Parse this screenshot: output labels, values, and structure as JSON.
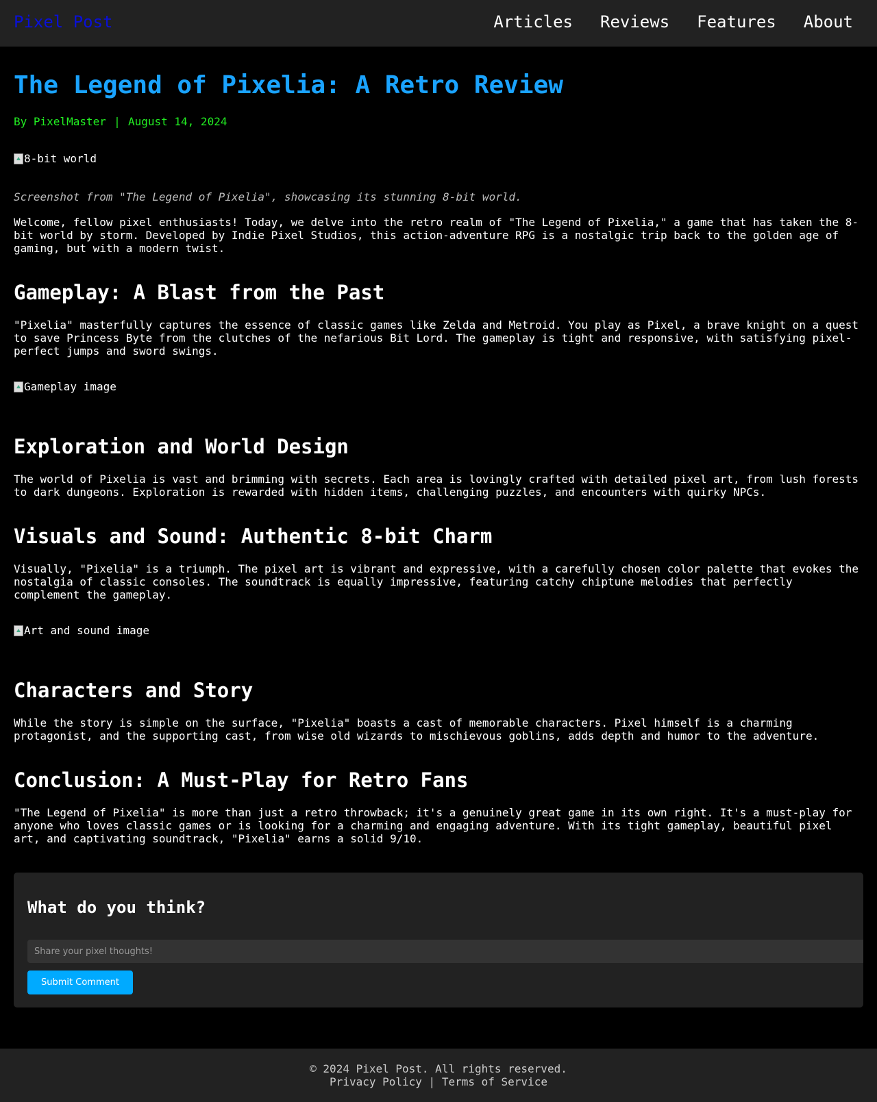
{
  "site": {
    "brand": "Pixel Post",
    "nav": [
      "Articles",
      "Reviews",
      "Features",
      "About"
    ]
  },
  "article": {
    "title": "The Legend of Pixelia: A Retro Review",
    "byline": {
      "author_prefix": "By PixelMaster",
      "separator": "|",
      "date": "August 14, 2024"
    },
    "hero_image_alt": "8-bit world",
    "hero_caption": "Screenshot from \"The Legend of Pixelia\", showcasing its stunning 8-bit world.",
    "intro": "Welcome, fellow pixel enthusiasts! Today, we delve into the retro realm of \"The Legend of Pixelia,\" a game that has taken the 8-bit world by storm. Developed by Indie Pixel Studios, this action-adventure RPG is a nostalgic trip back to the golden age of gaming, but with a modern twist.",
    "sections": [
      {
        "heading": "Gameplay: A Blast from the Past",
        "text": "\"Pixelia\" masterfully captures the essence of classic games like Zelda and Metroid. You play as Pixel, a brave knight on a quest to save Princess Byte from the clutches of the nefarious Bit Lord. The gameplay is tight and responsive, with satisfying pixel-perfect jumps and sword swings.",
        "image_alt": "Gameplay image"
      },
      {
        "heading": "Exploration and World Design",
        "text": "The world of Pixelia is vast and brimming with secrets. Each area is lovingly crafted with detailed pixel art, from lush forests to dark dungeons. Exploration is rewarded with hidden items, challenging puzzles, and encounters with quirky NPCs."
      },
      {
        "heading": "Visuals and Sound: Authentic 8-bit Charm",
        "text": "Visually, \"Pixelia\" is a triumph. The pixel art is vibrant and expressive, with a carefully chosen color palette that evokes the nostalgia of classic consoles. The soundtrack is equally impressive, featuring catchy chiptune melodies that perfectly complement the gameplay.",
        "image_alt": "Art and sound image"
      },
      {
        "heading": "Characters and Story",
        "text": "While the story is simple on the surface, \"Pixelia\" boasts a cast of memorable characters. Pixel himself is a charming protagonist, and the supporting cast, from wise old wizards to mischievous goblins, adds depth and humor to the adventure."
      },
      {
        "heading": "Conclusion: A Must-Play for Retro Fans",
        "text": "\"The Legend of Pixelia\" is more than just a retro throwback; it's a genuinely great game in its own right. It's a must-play for anyone who loves classic games or is looking for a charming and engaging adventure. With its tight gameplay, beautiful pixel art, and captivating soundtrack, \"Pixelia\" earns a solid 9/10."
      }
    ]
  },
  "comments": {
    "title": "What do you think?",
    "placeholder": "Share your pixel thoughts!",
    "value": "",
    "submit_label": "Submit Comment"
  },
  "footer": {
    "copyright": "© 2024 Pixel Post. All rights reserved.",
    "privacy": "Privacy Policy",
    "separator": "|",
    "terms": "Terms of Service"
  },
  "colors": {
    "background": "#000000",
    "panel": "#222222",
    "title_accent": "#1aa3ff",
    "byline": "#22ee22",
    "brand": "#0a10d8",
    "button": "#00aaff"
  },
  "icons": {
    "broken_image": "broken-image-icon"
  }
}
